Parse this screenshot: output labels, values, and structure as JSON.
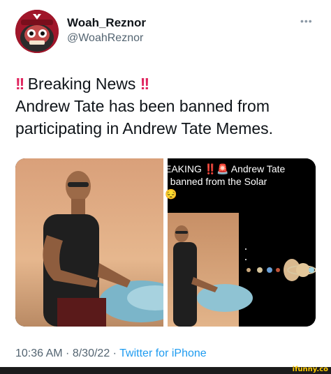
{
  "user": {
    "display_name": "Woah_Reznor",
    "handle": "@WoahReznor",
    "more_icon": "ellipsis-icon"
  },
  "tweet": {
    "alert_left": "!!",
    "headline": " Breaking News",
    "alert_right": "!!",
    "line2": "Andrew Tate has been banned from",
    "line3": "participating in Andrew Tate Memes."
  },
  "media": {
    "caption_line1": "EAKING ‼️🚨 Andrew Tate",
    "caption_line2": "t banned from the Solar",
    "caption_line3": "😔"
  },
  "meta": {
    "time": "10:36 AM",
    "sep1": " · ",
    "date": "8/30/22",
    "sep2": " · ",
    "source": "Twitter for iPhone"
  },
  "watermark": "ifunny.co",
  "colors": {
    "link": "#1d9bf0",
    "secondary_text": "#536471",
    "alert_red": "#e0245e"
  }
}
